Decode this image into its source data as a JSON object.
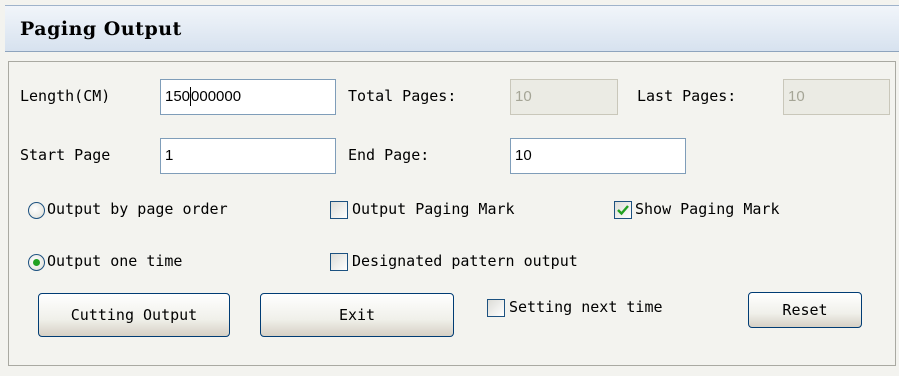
{
  "window": {
    "title": "Paging Output"
  },
  "length": {
    "label": "Length(CM)",
    "value_before_caret": "150",
    "value_after_caret": "000000"
  },
  "total_pages": {
    "label": "Total Pages:",
    "value": "10"
  },
  "last_pages": {
    "label": "Last Pages:",
    "value": "10"
  },
  "start_page": {
    "label": "Start Page",
    "value": "1"
  },
  "end_page": {
    "label": "End Page:",
    "value": "10"
  },
  "options": {
    "output_by_page_order": {
      "label": "Output by page order",
      "selected": false
    },
    "output_one_time": {
      "label": "Output one time",
      "selected": true
    },
    "output_paging_mark": {
      "label": "Output Paging Mark",
      "checked": false
    },
    "show_paging_mark": {
      "label": "Show Paging Mark",
      "checked": true
    },
    "designated_pattern_output": {
      "label": "Designated pattern output",
      "checked": false
    },
    "setting_next_time": {
      "label": "Setting next time",
      "checked": false
    }
  },
  "buttons": {
    "cutting_output": "Cutting Output",
    "exit": "Exit",
    "reset": "Reset"
  },
  "colors": {
    "check_mark": "#21a121",
    "radio_dot": "#21a121",
    "field_border": "#7f9db9",
    "disabled_text": "#a5a596"
  }
}
